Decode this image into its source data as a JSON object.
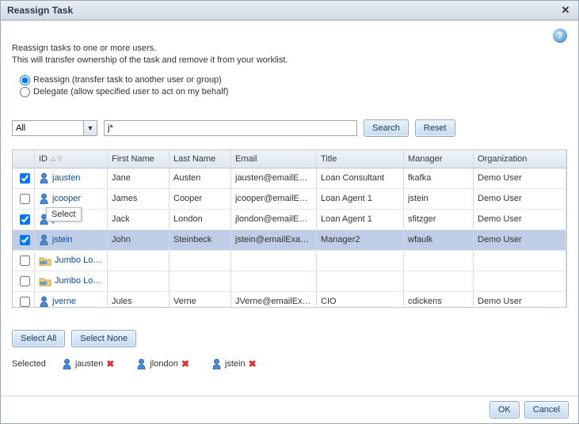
{
  "dialog": {
    "title": "Reassign Task",
    "info_line1": "Reassign tasks to one or more users.",
    "info_line2": "This will transfer ownership of the task and remove it from your worklist.",
    "radio_reassign": "Reassign (transfer task to another user or group)",
    "radio_delegate": "Delegate (allow specified user to act on my behalf)",
    "search_mode": "All",
    "search_value": "j*",
    "search_btn": "Search",
    "reset_btn": "Reset",
    "select_all": "Select All",
    "select_none": "Select None",
    "selected_label": "Selected",
    "ok_btn": "OK",
    "cancel_btn": "Cancel",
    "tooltip": "Select"
  },
  "columns": {
    "id": "ID",
    "first": "First Name",
    "last": "Last Name",
    "email": "Email",
    "title": "Title",
    "manager": "Manager",
    "org": "Organization"
  },
  "rows": [
    {
      "checked": true,
      "kind": "user",
      "id": "jausten",
      "first": "Jane",
      "last": "Austen",
      "email": "jausten@emailE…",
      "title": "Loan Consultant",
      "manager": "fkafka",
      "org": "Demo User",
      "selected": false
    },
    {
      "checked": false,
      "kind": "user",
      "id": "jcooper",
      "first": "James",
      "last": "Cooper",
      "email": "jcooper@emailE…",
      "title": "Loan Agent 1",
      "manager": "jstein",
      "org": "Demo User",
      "selected": false
    },
    {
      "checked": true,
      "kind": "user",
      "id": "jlondon",
      "first": "Jack",
      "last": "London",
      "email": "jlondon@emailE…",
      "title": "Loan Agent 1",
      "manager": "sfitzger",
      "org": "Demo User",
      "selected": false
    },
    {
      "checked": true,
      "kind": "user",
      "id": "jstein",
      "first": "John",
      "last": "Steinbeck",
      "email": "jstein@emailExa…",
      "title": "Manager2",
      "manager": "wfaulk",
      "org": "Demo User",
      "selected": true
    },
    {
      "checked": false,
      "kind": "group",
      "id": "Jumbo Lo…",
      "first": "",
      "last": "",
      "email": "",
      "title": "",
      "manager": "",
      "org": "",
      "selected": false
    },
    {
      "checked": false,
      "kind": "group",
      "id": "Jumbo Lo…",
      "first": "",
      "last": "",
      "email": "",
      "title": "",
      "manager": "",
      "org": "",
      "selected": false
    },
    {
      "checked": false,
      "kind": "user",
      "id": "jverne",
      "first": "Jules",
      "last": "Verne",
      "email": "JVerne@emailEx…",
      "title": "CIO",
      "manager": "cdickens",
      "org": "Demo User",
      "selected": false
    }
  ],
  "selected_users": [
    {
      "id": "jausten"
    },
    {
      "id": "jlondon"
    },
    {
      "id": "jstein"
    }
  ]
}
